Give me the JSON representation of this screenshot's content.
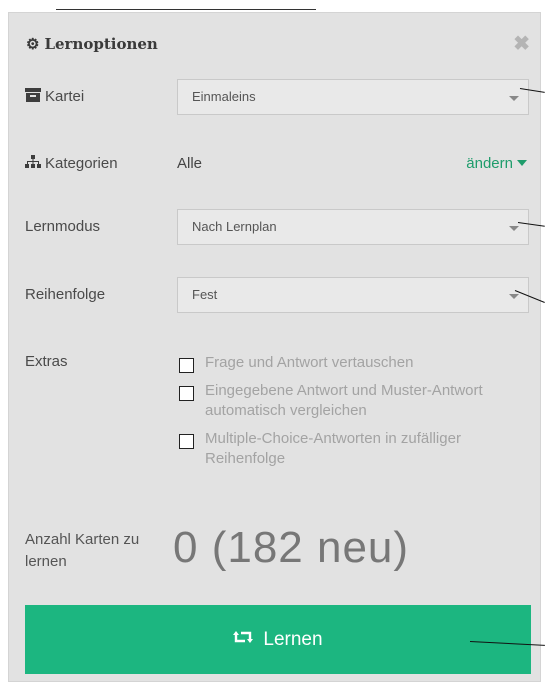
{
  "header": {
    "title": "Lernoptionen",
    "close": "✖"
  },
  "kartei": {
    "label": "Kartei",
    "value": "Einmaleins"
  },
  "kategorien": {
    "label": "Kategorien",
    "value": "Alle",
    "change_label": "ändern"
  },
  "lernmodus": {
    "label": "Lernmodus",
    "value": "Nach Lernplan"
  },
  "reihenfolge": {
    "label": "Reihenfolge",
    "value": "Fest"
  },
  "extras": {
    "label": "Extras",
    "options": [
      {
        "label": "Frage und Antwort vertauschen",
        "checked": false
      },
      {
        "label": "Eingegebene Antwort und Muster-Antwort automatisch vergleichen",
        "checked": false
      },
      {
        "label": "Multiple-Choice-Antworten in zufälliger Reihenfolge",
        "checked": false
      }
    ]
  },
  "count": {
    "label": "Anzahl Karten zu lernen",
    "value": "0 (182 neu)"
  },
  "learn_button": {
    "label": "Lernen"
  },
  "colors": {
    "accent": "#1cb680",
    "link": "#1e9c6b",
    "panel": "#e2e2e2"
  },
  "icons": {
    "title": "gear-icon",
    "close": "close-icon",
    "kartei": "archive-icon",
    "kategorien": "sitemap-icon",
    "learn": "retweet-icon"
  }
}
